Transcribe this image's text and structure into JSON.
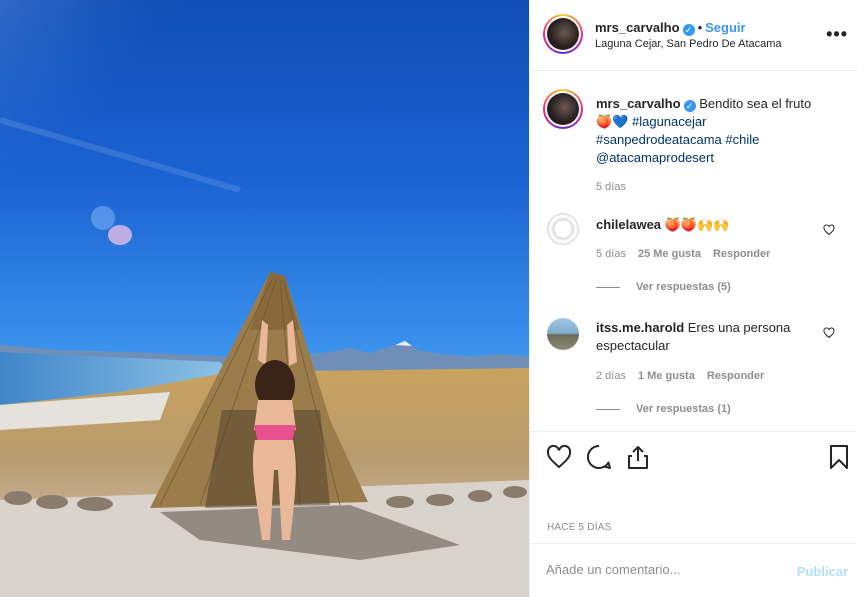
{
  "post": {
    "username": "mrs_carvalho",
    "follow_label": "Seguir",
    "separator": "•",
    "location": "Laguna Cejar, San Pedro De Atacama",
    "more_label": "•••"
  },
  "caption": {
    "username": "mrs_carvalho",
    "text": "Bendito sea el fruto",
    "emoji": "🍑💙",
    "hashtag1": "#lagunacejar",
    "hashtag2": "#sanpedrodeatacama",
    "hashtag3": "#chile",
    "mention": "@atacamaprodesert",
    "time": "5 días"
  },
  "comments": [
    {
      "username": "chilelawea",
      "text": "🍑🍑🙌🙌",
      "time": "5 días",
      "likes": "25 Me gusta",
      "reply_label": "Responder",
      "view_replies": "Ver respuestas (5)"
    },
    {
      "username": "itss.me.harold",
      "text": "Eres una persona espectacular",
      "time": "2 días",
      "likes": "1 Me gusta",
      "reply_label": "Responder",
      "view_replies": "Ver respuestas (1)"
    }
  ],
  "footer": {
    "time_ago": "HACE 5 DÍAS",
    "comment_placeholder": "Añade un comentario...",
    "publish_label": "Publicar"
  },
  "colors": {
    "accent": "#3897f0",
    "muted": "#8e8e8e",
    "publish_disabled": "#b2dffc"
  },
  "icons": [
    "heart-icon",
    "comment-icon",
    "share-icon",
    "bookmark-icon",
    "verified-icon",
    "more-icon"
  ]
}
